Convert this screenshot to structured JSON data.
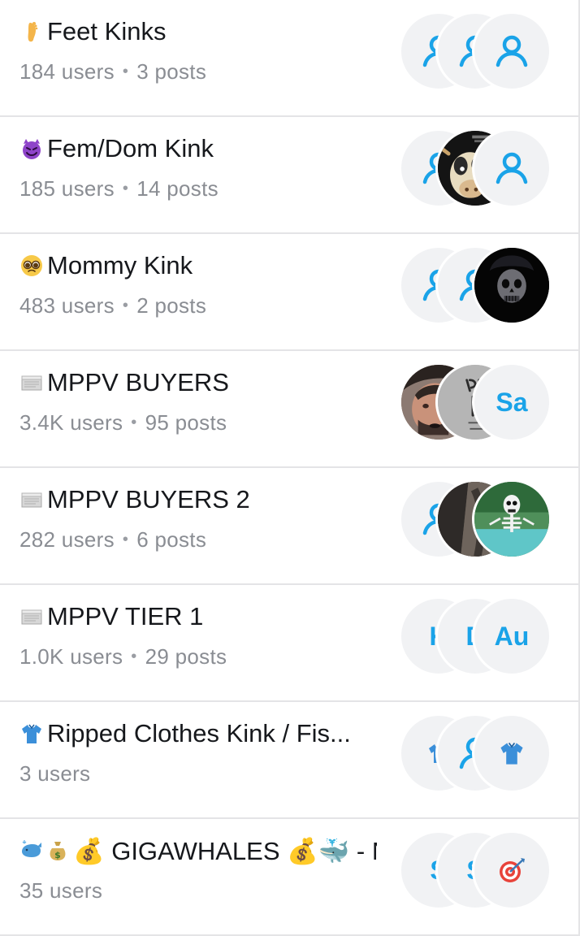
{
  "colors": {
    "accent": "#1aa3e8",
    "text": "#16181c",
    "muted": "#8a8d93",
    "divider": "#e4e4e6",
    "avatar_bg": "#f1f2f4"
  },
  "rows": [
    {
      "emoji": "foot-emoji",
      "title": "Feet Kinks",
      "users": "184 users",
      "posts": "3 posts",
      "avatars": [
        "user-icon",
        "user-icon",
        "user-icon"
      ]
    },
    {
      "emoji": "smiling-devil-emoji",
      "title": "Fem/Dom Kink",
      "users": "185 users",
      "posts": "14 posts",
      "avatars": [
        "user-icon",
        "cow-photo",
        "user-icon"
      ]
    },
    {
      "emoji": "pleading-face-emoji",
      "title": "Mommy Kink",
      "users": "483 users",
      "posts": "2 posts",
      "avatars": [
        "user-icon",
        "user-icon",
        "skull-photo"
      ]
    },
    {
      "emoji": "scroll-emoji",
      "title": "MPPV BUYERS",
      "users": "3.4K users",
      "posts": "95 posts",
      "avatars": [
        "man-photo",
        "graffiti-photo",
        "initials"
      ],
      "initials": [
        "",
        "",
        "Sa"
      ]
    },
    {
      "emoji": "scroll-emoji",
      "title": "MPPV BUYERS 2",
      "users": "282 users",
      "posts": "6 posts",
      "avatars": [
        "user-icon",
        "dark-photo",
        "skeleton-photo"
      ]
    },
    {
      "emoji": "scroll-emoji",
      "title": "MPPV TIER 1",
      "users": "1.0K users",
      "posts": "29 posts",
      "avatars": [
        "initials",
        "initials",
        "initials"
      ],
      "initials": [
        "K",
        "D",
        "Au"
      ]
    },
    {
      "emoji": "shirt-emoji",
      "title": "Ripped Clothes Kink / Fis...",
      "users": "3 users",
      "posts": "",
      "avatars": [
        "shirt-icon",
        "user-icon",
        "shirt-icon"
      ]
    },
    {
      "emoji": "whale-moneybag-emoji",
      "title": "💰 GIGAWHALES 💰🐳 - N...",
      "users": "35 users",
      "posts": "",
      "avatars": [
        "initials",
        "initials",
        "target-icon"
      ],
      "initials": [
        "S",
        "S",
        ""
      ]
    }
  ]
}
